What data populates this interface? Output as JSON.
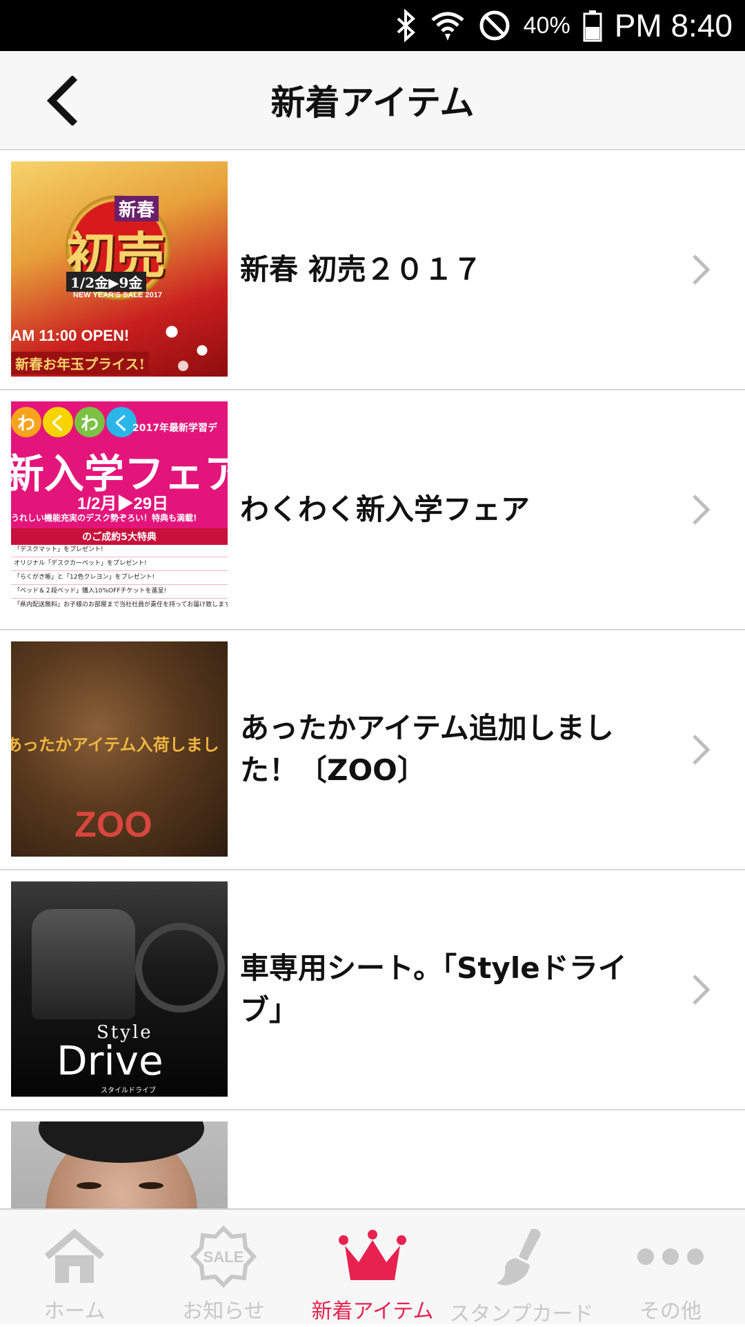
{
  "status_bar": {
    "battery_percent": "40%",
    "time": "PM 8:40",
    "icons": [
      "bluetooth-icon",
      "wifi-icon",
      "do-not-disturb-icon",
      "battery-icon"
    ]
  },
  "header": {
    "title": "新着アイテム",
    "back_icon": "chevron-left-icon"
  },
  "items": [
    {
      "label": "新春 初売２０１７",
      "thumb": {
        "badge": "新春",
        "main": "初売",
        "dates": "1/2金▶9金",
        "sub": "NEW YEAR'S SALE 2017",
        "open": "AM 11:00 OPEN!",
        "bottom": "新春お年玉プライス!"
      }
    },
    {
      "label": "わくわく新入学フェア",
      "thumb": {
        "bubbles": [
          "わ",
          "く",
          "わ",
          "く"
        ],
        "year": "2017年最新学習デ",
        "main": "新入学フェア",
        "dates": "1/2月▶29日",
        "tagline": "うれしい機能充実のデスク勢ぞろい！特典も満載!",
        "perk_title": "のご成約5大特典",
        "perks": [
          "「デスクマット」をプレゼント!",
          "オリジナル「デスクカーペット」をプレゼント!",
          "「らくがき帳」と「12色クレヨン」をプレゼント!",
          "「ベッド＆２段ベッド」購入10%OFFチケットを進呈!",
          "「県内配送無料」お子様のお部屋まで当社社員が責任を持ってお届け致します"
        ]
      }
    },
    {
      "label": "あったかアイテム追加しました！〔ZOO〕",
      "thumb": {
        "caption": "あったかアイテム入荷しまし",
        "brand": "ZOO"
      }
    },
    {
      "label": "車専用シート。「Styleドライブ」",
      "thumb": {
        "style": "Style",
        "drive": "Drive",
        "kana": "スタイルドライブ"
      }
    },
    {
      "label": "",
      "thumb": {}
    }
  ],
  "tabs": [
    {
      "label": "ホーム",
      "icon": "home-icon",
      "active": false
    },
    {
      "label": "お知らせ",
      "icon": "sale-tag-icon",
      "icon_text": "SALE",
      "active": false
    },
    {
      "label": "新着アイテム",
      "icon": "crown-icon",
      "active": true
    },
    {
      "label": "スタンプカード",
      "icon": "stamp-icon",
      "active": false
    },
    {
      "label": "その他",
      "icon": "more-dots-icon",
      "active": false
    }
  ],
  "colors": {
    "accent": "#e8224f",
    "inactive": "#c8c8c8",
    "divider": "#d9d9d9"
  }
}
